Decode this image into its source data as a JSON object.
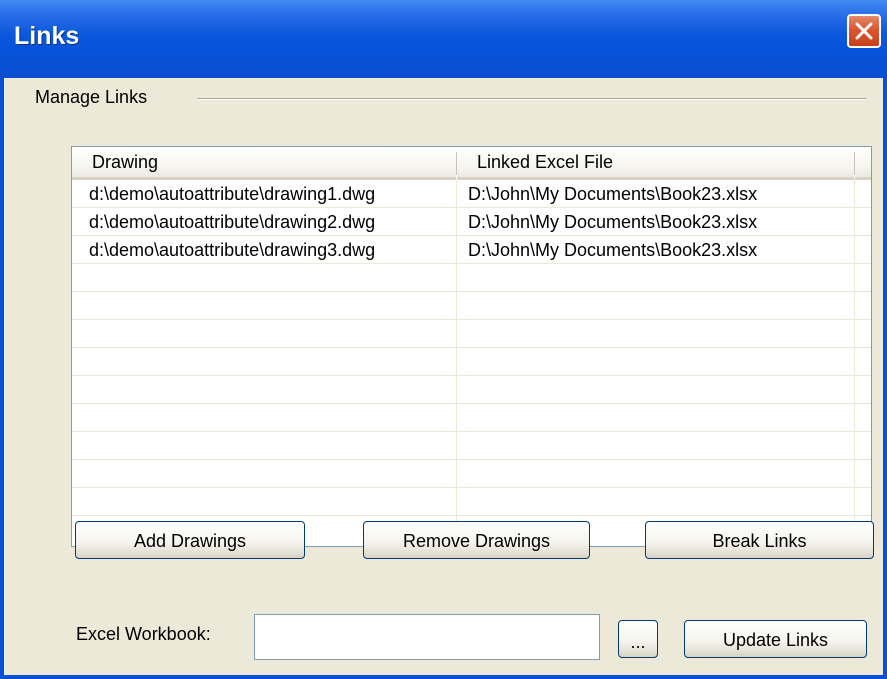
{
  "window": {
    "title": "Links"
  },
  "group": {
    "label": "Manage Links"
  },
  "table": {
    "columns": [
      "Drawing",
      "Linked Excel File"
    ],
    "rows": [
      [
        "d:\\demo\\autoattribute\\drawing1.dwg",
        "D:\\John\\My Documents\\Book23.xlsx"
      ],
      [
        "d:\\demo\\autoattribute\\drawing2.dwg",
        "D:\\John\\My Documents\\Book23.xlsx"
      ],
      [
        "d:\\demo\\autoattribute\\drawing3.dwg",
        "D:\\John\\My Documents\\Book23.xlsx"
      ]
    ],
    "empty_rows": 9
  },
  "buttons": {
    "add": "Add Drawings",
    "remove": "Remove Drawings",
    "break": "Break Links",
    "browse": "...",
    "update": "Update Links"
  },
  "workbook": {
    "label": "Excel Workbook:",
    "value": ""
  },
  "icons": {
    "close": "close-icon"
  },
  "colors": {
    "titlebar": "#0752d8",
    "close": "#d9572f",
    "face": "#ece9d8",
    "border": "#7f9db9"
  }
}
